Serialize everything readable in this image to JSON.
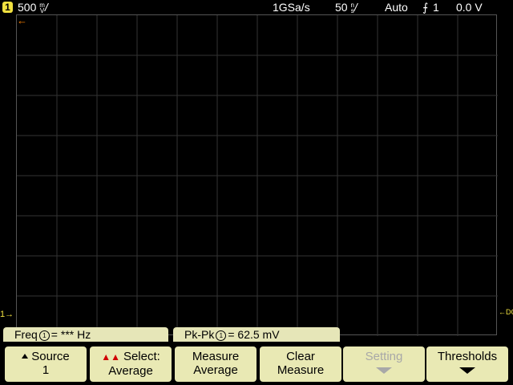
{
  "status_bar": {
    "channel": "1",
    "vdiv_value": "500",
    "vdiv_unit_top": "m",
    "vdiv_unit_bottom": "V",
    "sample_rate": "1GSa/s",
    "tdiv_value": "50",
    "tdiv_unit_top": "n",
    "tdiv_unit_bottom": "s",
    "trigger_mode": "Auto",
    "trigger_source": "1",
    "trigger_level": "0.0 V"
  },
  "markers": {
    "ground_label": "1",
    "trigger_label": "T",
    "dc_label": "DC"
  },
  "measurements": [
    {
      "label": "Freq",
      "channel": "1",
      "value": "*** Hz"
    },
    {
      "label": "Pk-Pk",
      "channel": "1",
      "value": "62.5 mV"
    }
  ],
  "softkeys": {
    "source": {
      "line1": "Source",
      "line2": "1"
    },
    "select": {
      "line1": "Select:",
      "line2": "Average"
    },
    "measure": {
      "line1": "Measure",
      "line2": "Average"
    },
    "clear": {
      "line1": "Clear",
      "line2": "Measure"
    },
    "setting": {
      "line1": "Setting"
    },
    "thresholds": {
      "line1": "Thresholds"
    }
  },
  "colors": {
    "background": "#000000",
    "channel1": "#f0e040",
    "trigger_marker": "#ff8000",
    "softkey": "#e9e9b4",
    "grid": "#555555"
  }
}
